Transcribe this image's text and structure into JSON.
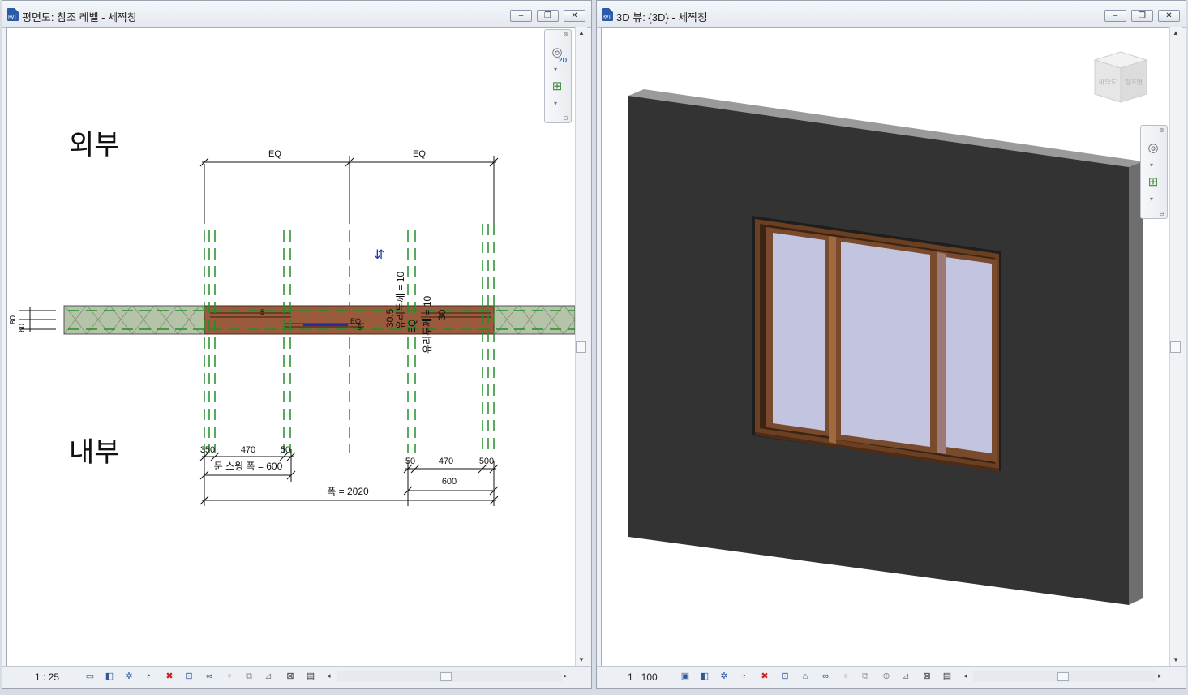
{
  "left_view": {
    "title": "평면도: 참조 레벨 - 세짝창",
    "exterior_label": "외부",
    "interior_label": "내부",
    "scale": "1 : 25",
    "nav_2d_label": "2D",
    "dims": {
      "eq": "EQ",
      "bottom_left": [
        "350",
        "470",
        "50"
      ],
      "bottom_right": [
        "50",
        "470",
        "500"
      ],
      "door_swing": "문 스윙 폭 = 600",
      "right_600": "600",
      "width": "폭 = 2020",
      "glass_thk": "유리두께 = 10",
      "small_5": "5",
      "eq_small": "EQ",
      "d30_5": "30.5",
      "d30": "30",
      "wall_80": "80",
      "wall_60": "60"
    }
  },
  "right_view": {
    "title": "3D 뷰: {3D} - 세짝창",
    "scale": "1 : 100",
    "viewcube_face1": "바닥도",
    "viewcube_face2": "참조면"
  },
  "window_controls": {
    "minimize": "–",
    "restore": "❐",
    "close": "✕"
  },
  "colors": {
    "wall_hatch": "#b5c4a8",
    "window_frame": "#9a5a3c",
    "dashed_ref": "#1f8f2a",
    "wall_3d": "#333333",
    "glass": "#c2c4e0",
    "frame_3d": "#6b3f22"
  }
}
